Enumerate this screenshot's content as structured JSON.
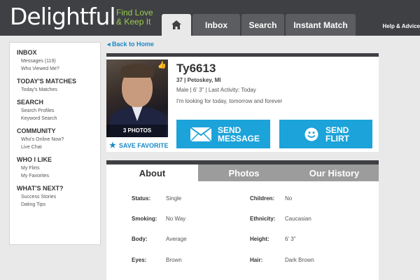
{
  "header": {
    "logo": "Delightful",
    "tagline_line1": "Find Love",
    "tagline_line2": "& Keep It",
    "nav": [
      "Inbox",
      "Search",
      "Instant Match"
    ],
    "help": "Help & Advice"
  },
  "sidebar": {
    "sections": [
      {
        "title": "INBOX",
        "items": [
          "Messages (119)",
          "Who Viewed Me?"
        ]
      },
      {
        "title": "TODAY'S MATCHES",
        "items": [
          "Today's Matches"
        ]
      },
      {
        "title": "SEARCH",
        "items": [
          "Search Profiles",
          "Keyword Search"
        ]
      },
      {
        "title": "COMMUNITY",
        "items": [
          "Who's Online Now?",
          "Live Chat"
        ]
      },
      {
        "title": "WHO I LIKE",
        "items": [
          "My Flirts",
          "My Favorites"
        ]
      },
      {
        "title": "WHAT'S NEXT?",
        "items": [
          "Success Stories",
          "Dating Tips"
        ]
      }
    ]
  },
  "back_link": "Back to Home",
  "profile": {
    "username": "Ty6613",
    "age_location": "37 | Petoskey, MI",
    "details": "Male  |  6' 3\"  |  Last Activity: Today",
    "headline": "I'm looking for today, tomorrow and forever",
    "photos_count": "3 PHOTOS",
    "save_favorite": "SAVE FAVORITE",
    "send_message_line1": "SEND",
    "send_message_line2": "MESSAGE",
    "send_flirt_line1": "SEND",
    "send_flirt_line2": "FLIRT"
  },
  "tabs": [
    "About",
    "Photos",
    "Our History"
  ],
  "about": {
    "left": [
      {
        "label": "Status:",
        "value": "Single"
      },
      {
        "label": "Smoking:",
        "value": "No Way"
      },
      {
        "label": "Body:",
        "value": "Average"
      },
      {
        "label": "Eyes:",
        "value": "Brown"
      }
    ],
    "right": [
      {
        "label": "Children:",
        "value": "No"
      },
      {
        "label": "Ethnicity:",
        "value": "Caucasian"
      },
      {
        "label": "Height:",
        "value": "6' 3\""
      },
      {
        "label": "Hair:",
        "value": "Dark Brown"
      }
    ]
  },
  "colors": {
    "header": "#3f4043",
    "accent_blue": "#1ca3d9",
    "tagline_green": "#9acd4f",
    "tab_inactive": "#9c9c9c"
  }
}
